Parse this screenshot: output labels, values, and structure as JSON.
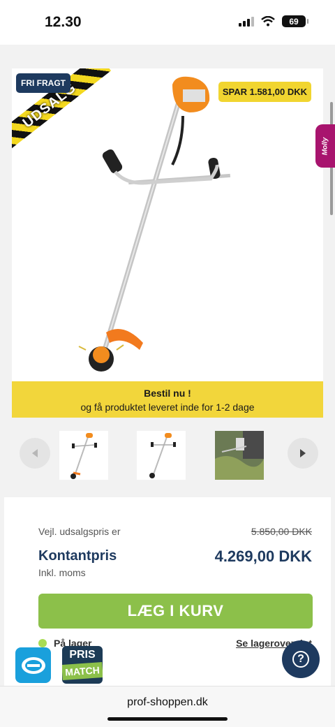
{
  "status_bar": {
    "time": "12.30",
    "battery": "69"
  },
  "product": {
    "ribbon_text": "UDSALG",
    "badge_free_shipping": "FRI FRAGT",
    "badge_savings": "SPAR 1.581,00 DKK",
    "order_banner_title": "Bestil nu !",
    "order_banner_text": "og få produktet leveret inde for 1-2 dage",
    "side_tab_label": "Molly"
  },
  "pricing": {
    "recommended_label": "Vejl. udsalgspris er",
    "recommended_price": "5.850,00 DKK",
    "cash_price_label": "Kontantpris",
    "cash_price": "4.269,00 DKK",
    "vat_note": "Inkl. moms",
    "add_to_cart": "LÆG I KURV",
    "stock_status": "På lager",
    "stock_overview_link": "Se lageroversigt"
  },
  "badges": {
    "prismatch_line1": "PRIS",
    "prismatch_line2": "MATCH",
    "help": "?"
  },
  "browser": {
    "url": "prof-shoppen.dk"
  },
  "colors": {
    "navy": "#1e3a5f",
    "cart_green": "#8cc04a",
    "banner_yellow": "#f2d63b",
    "tab_magenta": "#a8146e",
    "emaerket_blue": "#1aa0dc"
  },
  "icons": [
    "signal-icon",
    "wifi-icon",
    "battery-icon",
    "chevron-left-icon",
    "chevron-right-icon",
    "emaerket-icon",
    "help-icon"
  ]
}
